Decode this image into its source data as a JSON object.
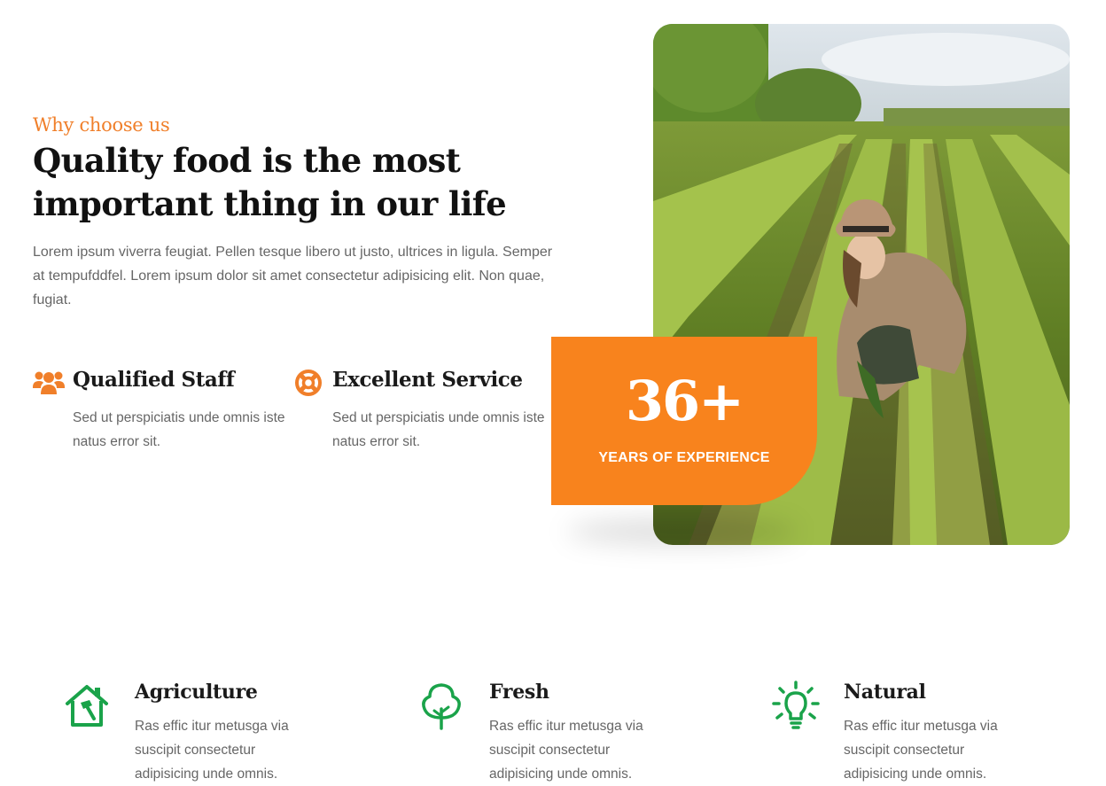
{
  "intro": {
    "eyebrow": "Why choose us",
    "headline_line1": "Quality food is the most",
    "headline_line2": "important thing in our life",
    "description": "Lorem ipsum viverra feugiat. Pellen tesque libero ut justo, ultrices in ligula. Semper at tempufddfel. Lorem ipsum dolor sit amet consectetur adipisicing elit. Non quae, fugiat."
  },
  "features": [
    {
      "icon": "users-icon",
      "title": "Qualified Staff",
      "text": "Sed ut perspiciatis unde omnis iste natus error sit."
    },
    {
      "icon": "lifebuoy-icon",
      "title": "Excellent Service",
      "text": "Sed ut perspiciatis unde omnis iste natus error sit."
    }
  ],
  "experience": {
    "number": "36+",
    "label": "YEARS OF EXPERIENCE"
  },
  "photo": {
    "icon": "farm-field-photo"
  },
  "services": [
    {
      "icon": "home-hammer-icon",
      "title": "Agriculture",
      "text": "Ras effic itur metusga via suscipit consectetur adipisicing unde omnis."
    },
    {
      "icon": "tree-icon",
      "title": "Fresh",
      "text": "Ras effic itur metusga via suscipit consectetur adipisicing unde omnis."
    },
    {
      "icon": "lightbulb-icon",
      "title": "Natural",
      "text": "Ras effic itur metusga via suscipit consectetur adipisicing unde omnis."
    }
  ],
  "colors": {
    "accent_orange": "#f8831d",
    "eyebrow_orange": "#f07f2a",
    "icon_green": "#1aa34a",
    "text_gray": "#666666",
    "heading": "#111111"
  }
}
